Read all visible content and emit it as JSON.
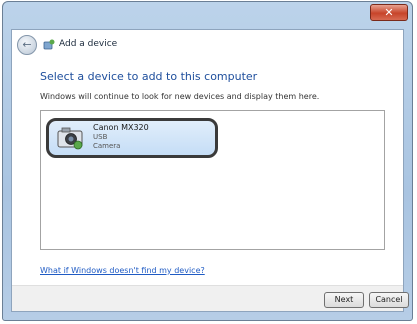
{
  "window": {
    "close_glyph": "✕",
    "wizard_title": "Add a device"
  },
  "header": {
    "back_glyph": "←"
  },
  "content": {
    "heading": "Select a device to add to this computer",
    "subtext": "Windows will continue to look for new devices and display them here.",
    "device": {
      "name": "Canon MX320",
      "type": "USB",
      "status": "Camera",
      "icon": "camera-device-icon"
    },
    "help_link": "What if Windows doesn't find my device?"
  },
  "footer": {
    "next_label": "Next",
    "cancel_label": "Cancel"
  },
  "colors": {
    "accent_heading": "#1e4e9c",
    "link": "#1f5bc4",
    "selection": "#c5ddf6",
    "close_button": "#c7442a"
  }
}
